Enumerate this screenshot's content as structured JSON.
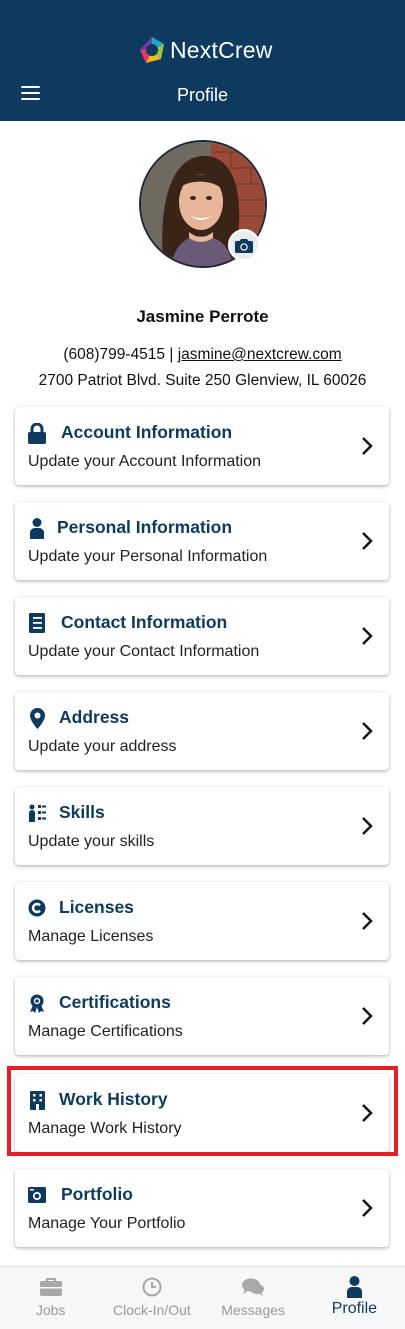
{
  "header": {
    "brand": "NextCrew",
    "title": "Profile"
  },
  "profile": {
    "name": "Jasmine Perrote",
    "phone": "(608)799-4515",
    "separator": "|",
    "email": "jasmine@nextcrew.com",
    "address": "2700 Patriot Blvd. Suite 250 Glenview, IL 60026"
  },
  "menu": [
    {
      "title": "Account Information",
      "subtitle": "Update your Account Information",
      "icon": "lock-icon"
    },
    {
      "title": "Personal Information",
      "subtitle": "Update your Personal Information",
      "icon": "person-icon"
    },
    {
      "title": "Contact Information",
      "subtitle": "Update your Contact Information",
      "icon": "address-book-icon"
    },
    {
      "title": "Address",
      "subtitle": "Update your address",
      "icon": "map-pin-icon"
    },
    {
      "title": "Skills",
      "subtitle": "Update your skills",
      "icon": "skills-icon"
    },
    {
      "title": "Licenses",
      "subtitle": "Manage Licenses",
      "icon": "copyright-icon"
    },
    {
      "title": "Certifications",
      "subtitle": "Manage Certifications",
      "icon": "award-icon"
    },
    {
      "title": "Work History",
      "subtitle": "Manage Work History",
      "icon": "building-icon"
    },
    {
      "title": "Portfolio",
      "subtitle": "Manage Your Portfolio",
      "icon": "photo-icon"
    }
  ],
  "bottom_nav": [
    {
      "label": "Jobs",
      "icon": "briefcase-icon"
    },
    {
      "label": "Clock-In/Out",
      "icon": "clock-icon"
    },
    {
      "label": "Messages",
      "icon": "chat-icon"
    },
    {
      "label": "Profile",
      "icon": "user-icon",
      "active": true
    }
  ],
  "colors": {
    "brand_navy": "#0d3a5e",
    "highlight": "#e3202a"
  }
}
